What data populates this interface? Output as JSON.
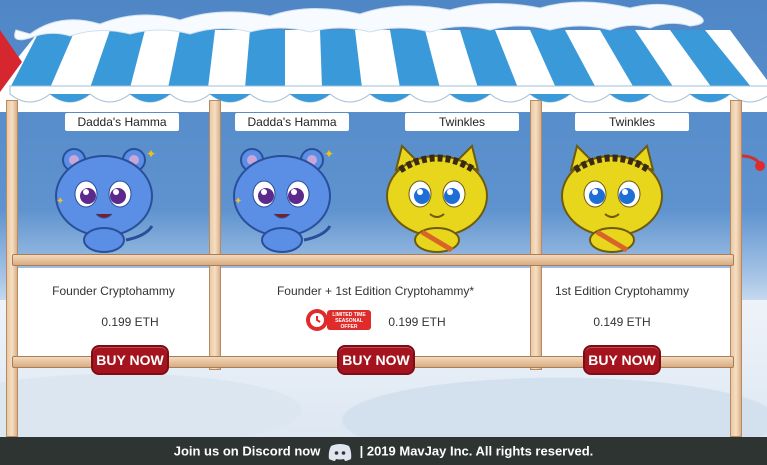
{
  "stall": {
    "slots": [
      {
        "name": "Dadda's Hamma",
        "variant": "blue"
      },
      {
        "name": "Dadda's Hamma",
        "variant": "blue"
      },
      {
        "name": "Twinkles",
        "variant": "yellow"
      },
      {
        "name": "Twinkles",
        "variant": "yellow"
      }
    ]
  },
  "products": [
    {
      "title": "Founder Cryptohammy",
      "price": "0.199 ETH",
      "button": "BUY NOW"
    },
    {
      "title": "Founder + 1st Edition Cryptohammy*",
      "price": "0.199 ETH",
      "button": "BUY NOW"
    },
    {
      "title": "1st Edition Cryptohammy",
      "price": "0.149 ETH",
      "button": "BUY NOW"
    }
  ],
  "badge": {
    "lines": [
      "LIMITED TIME",
      "SEASONAL",
      "OFFER"
    ],
    "icon": "timer-icon"
  },
  "footer": {
    "join_text": "Join us on Discord now",
    "copyright": "| 2019 MavJay Inc. All rights reserved.",
    "icon": "discord-icon"
  },
  "colors": {
    "button": "#a5141e",
    "blue_hammy": "#5b8fe6",
    "yellow_hammy": "#e8d61c",
    "awning_blue": "#3a9ad9",
    "footer": "#2d3431"
  }
}
